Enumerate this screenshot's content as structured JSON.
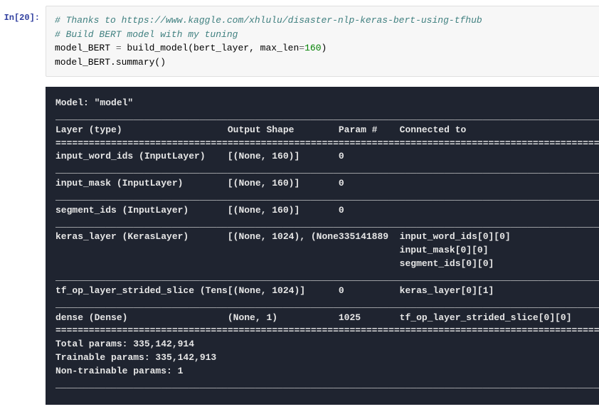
{
  "prompt": "In[20]:",
  "code": {
    "comment1": "# Thanks to https://www.kaggle.com/xhlulu/disaster-nlp-keras-bert-using-tfhub",
    "comment2": "# Build BERT model with my tuning",
    "line3_var": "model_BERT",
    "line3_eq": " = ",
    "line3_func": "build_model",
    "line3_open": "(bert_layer, max_len",
    "line3_eq2": "=",
    "line3_num": "160",
    "line3_close": ")",
    "line4": "model_BERT.summary()"
  },
  "output": {
    "model_line": "Model: \"model\"",
    "header_layer": "Layer (type)",
    "header_output": "Output Shape",
    "header_param": "Param #",
    "header_connected": "Connected to",
    "rows": [
      {
        "layer": "input_word_ids (InputLayer)",
        "shape": "[(None, 160)]",
        "param": "0",
        "connected": [
          ""
        ]
      },
      {
        "layer": "input_mask (InputLayer)",
        "shape": "[(None, 160)]",
        "param": "0",
        "connected": [
          ""
        ]
      },
      {
        "layer": "segment_ids (InputLayer)",
        "shape": "[(None, 160)]",
        "param": "0",
        "connected": [
          ""
        ]
      },
      {
        "layer": "keras_layer (KerasLayer)",
        "shape": "[(None, 1024), (None",
        "param": "335141889",
        "connected": [
          "input_word_ids[0][0]",
          "input_mask[0][0]",
          "segment_ids[0][0]"
        ]
      },
      {
        "layer": "tf_op_layer_strided_slice (Tens",
        "shape": "[(None, 1024)]",
        "param": "0",
        "connected": [
          "keras_layer[0][1]"
        ]
      },
      {
        "layer": "dense (Dense)",
        "shape": "(None, 1)",
        "param": "1025",
        "connected": [
          "tf_op_layer_strided_slice[0][0]"
        ]
      }
    ],
    "total_params": "Total params: 335,142,914",
    "trainable_params": "Trainable params: 335,142,913",
    "nontrainable_params": "Non-trainable params: 1",
    "col_widths": {
      "layer": 31,
      "shape": 20,
      "param": 11,
      "connected": 34
    },
    "line_width": 100
  }
}
